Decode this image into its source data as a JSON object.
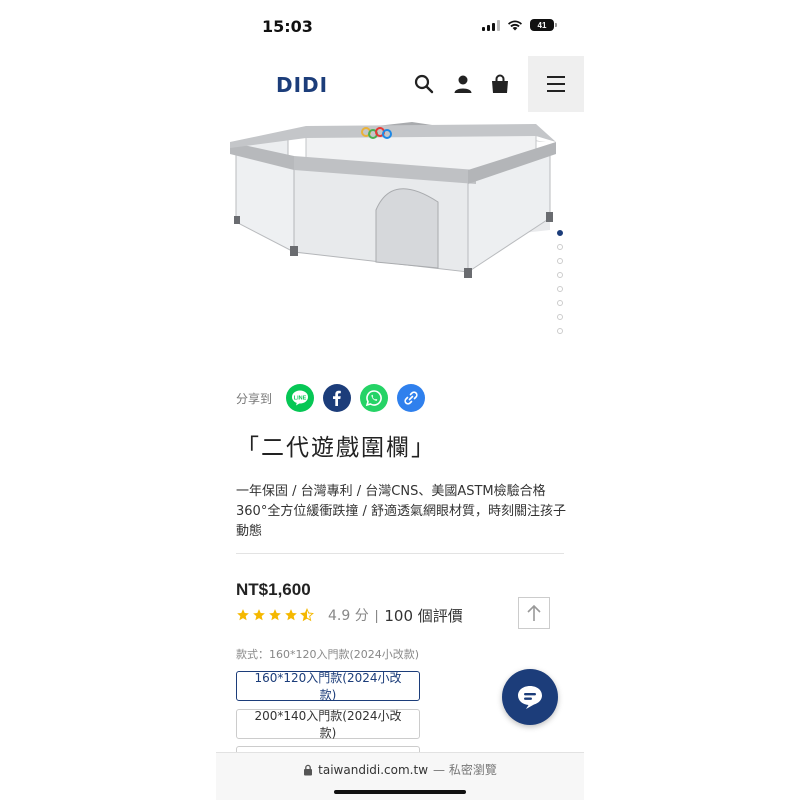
{
  "status_bar": {
    "time": "15:03",
    "battery": "41"
  },
  "header": {
    "logo": "DIDI",
    "search_icon": "search-icon",
    "account_icon": "user-icon",
    "cart_icon": "shopping-bag-icon",
    "menu_icon": "hamburger-icon"
  },
  "gallery": {
    "image": "gray baby playpen",
    "slide_count": 8,
    "active_slide": 1
  },
  "share": {
    "label": "分享到",
    "buttons": [
      {
        "name": "LINE",
        "icon": "line-icon",
        "color": "#06C755"
      },
      {
        "name": "Facebook",
        "icon": "facebook-icon",
        "color": "#1877F2"
      },
      {
        "name": "WhatsApp",
        "icon": "whatsapp-icon",
        "color": "#25D366"
      },
      {
        "name": "Copy link",
        "icon": "link-icon",
        "color": "#2F80ED"
      }
    ]
  },
  "product": {
    "title": "「二代遊戲圍欄」",
    "description": "一年保固 / 台灣專利 / 台灣CNS、美國ASTM檢驗合格360°全方位緩衝跌撞 / 舒適透氣網眼材質，時刻關注孩子動態",
    "price": "NT$1,600",
    "rating": {
      "stars": 4.5,
      "score": "4.9 分",
      "separator": "|",
      "reviews": "100 個評價"
    }
  },
  "variants": {
    "label": "款式：160*120入門款(2024小改款)",
    "options": [
      "160*120入門款(2024小改款)",
      "200*140入門款(2024小改款)"
    ],
    "selected": 0
  },
  "browser": {
    "url": "taiwandidi.com.tw",
    "mode_note": "— 私密瀏覽"
  },
  "colors": {
    "brand": "#1C3D7A",
    "star": "#F5B800"
  }
}
